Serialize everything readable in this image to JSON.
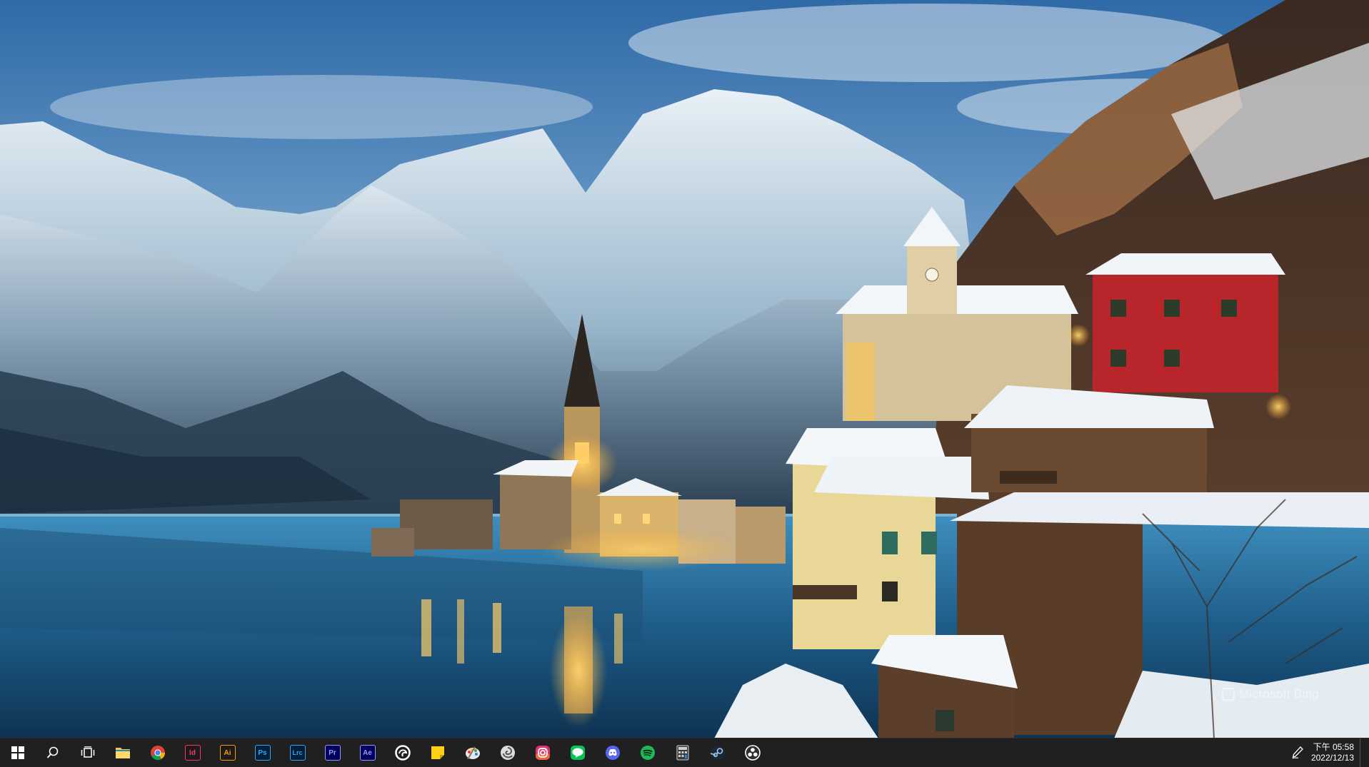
{
  "wallpaper": {
    "description_source": "desktop-background",
    "watermark_text": "Microsoft Bing"
  },
  "taskbar": {
    "system_buttons": [
      {
        "name": "start-button",
        "icon": "windows-logo-icon"
      },
      {
        "name": "search-button",
        "icon": "search-icon"
      },
      {
        "name": "task-view-button",
        "icon": "task-view-icon"
      }
    ],
    "apps": [
      {
        "name": "file-explorer",
        "icon": "folder-icon",
        "label": "",
        "color": "#f7c744"
      },
      {
        "name": "chrome",
        "icon": "chrome-icon",
        "label": "",
        "color": "#4285f4"
      },
      {
        "name": "indesign",
        "icon": "indesign-icon",
        "label": "Id",
        "color": "#ff3366"
      },
      {
        "name": "illustrator",
        "icon": "illustrator-icon",
        "label": "Ai",
        "color": "#ff9a00"
      },
      {
        "name": "photoshop",
        "icon": "photoshop-icon",
        "label": "Ps",
        "color": "#31a8ff"
      },
      {
        "name": "lightroom-classic",
        "icon": "lightroom-icon",
        "label": "Lrc",
        "color": "#31a8ff"
      },
      {
        "name": "premiere-pro",
        "icon": "premiere-icon",
        "label": "Pr",
        "color": "#9999ff"
      },
      {
        "name": "after-effects",
        "icon": "after-effects-icon",
        "label": "Ae",
        "color": "#9999ff"
      },
      {
        "name": "edge",
        "icon": "edge-icon",
        "label": "",
        "color": "#ffffff"
      },
      {
        "name": "sticky-notes",
        "icon": "sticky-notes-icon",
        "label": "",
        "color": "#fcd116"
      },
      {
        "name": "paint",
        "icon": "palette-icon",
        "label": "",
        "color": "#e8e8e8"
      },
      {
        "name": "app-swirl",
        "icon": "swirl-icon",
        "label": "",
        "color": "#dddddd"
      },
      {
        "name": "instagram",
        "icon": "instagram-icon",
        "label": "",
        "color": "#e1306c"
      },
      {
        "name": "line",
        "icon": "line-icon",
        "label": "",
        "color": "#06c755"
      },
      {
        "name": "discord",
        "icon": "discord-icon",
        "label": "",
        "color": "#5865f2"
      },
      {
        "name": "spotify",
        "icon": "spotify-icon",
        "label": "",
        "color": "#1db954"
      },
      {
        "name": "calculator",
        "icon": "calculator-icon",
        "label": "",
        "color": "#cfcfcf"
      },
      {
        "name": "steam",
        "icon": "steam-icon",
        "label": "",
        "color": "#9fc3e6"
      },
      {
        "name": "obs",
        "icon": "obs-icon",
        "label": "",
        "color": "#ffffff"
      }
    ],
    "tray": {
      "pen_icon": "pen-icon",
      "time": "下午 05:58",
      "date": "2022/12/13"
    }
  }
}
